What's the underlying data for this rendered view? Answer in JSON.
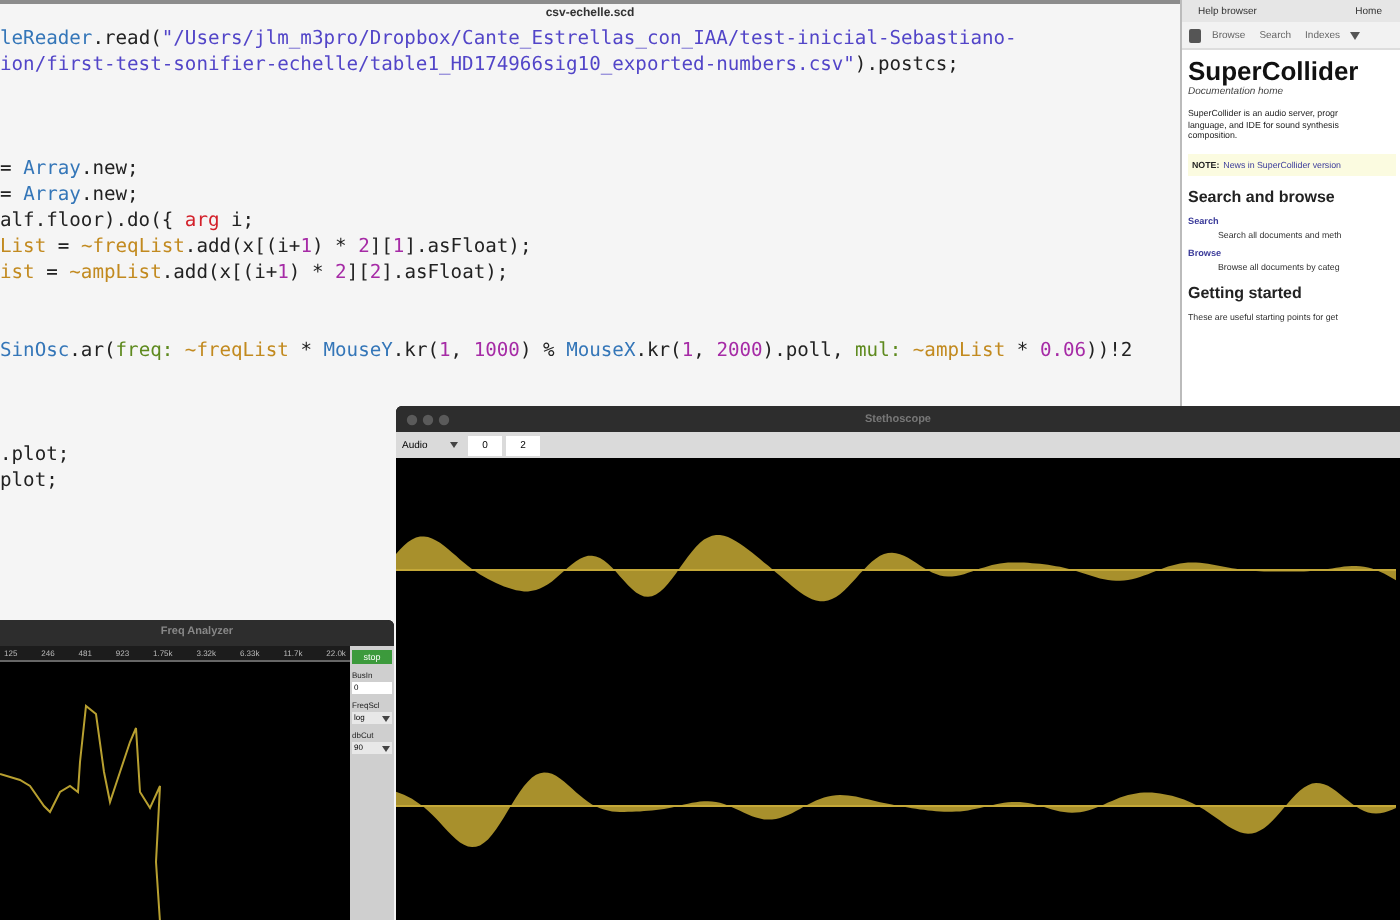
{
  "editor": {
    "title": "csv-echelle.scd",
    "lines": [
      {
        "kind": "code",
        "tokens": [
          {
            "text": "leReader",
            "kind": "class"
          },
          {
            "text": ".read(",
            "kind": "plain"
          },
          {
            "text": "\"/Users/jlm_m3pro/Dropbox/Cante_Estrellas_con_IAA/test-inicial-Sebastiano-",
            "kind": "string"
          }
        ]
      },
      {
        "kind": "code",
        "tokens": [
          {
            "text": "ion/first-test-sonifier-echelle/table1_HD174966sig10_exported-numbers.csv\"",
            "kind": "string"
          },
          {
            "text": ").postcs;",
            "kind": "plain"
          }
        ]
      },
      {
        "kind": "blank"
      },
      {
        "kind": "blank"
      },
      {
        "kind": "blank"
      },
      {
        "kind": "code",
        "tokens": [
          {
            "text": "= ",
            "kind": "plain"
          },
          {
            "text": "Array",
            "kind": "class"
          },
          {
            "text": ".new;",
            "kind": "plain"
          }
        ]
      },
      {
        "kind": "code",
        "tokens": [
          {
            "text": "= ",
            "kind": "plain"
          },
          {
            "text": "Array",
            "kind": "class"
          },
          {
            "text": ".new;",
            "kind": "plain"
          }
        ]
      },
      {
        "kind": "code",
        "tokens": [
          {
            "text": "alf.floor).do({ ",
            "kind": "plain"
          },
          {
            "text": "arg",
            "kind": "keyword"
          },
          {
            "text": " i;",
            "kind": "plain"
          }
        ]
      },
      {
        "kind": "code",
        "tokens": [
          {
            "text": "List",
            "kind": "env"
          },
          {
            "text": " = ",
            "kind": "plain"
          },
          {
            "text": "~freqList",
            "kind": "env"
          },
          {
            "text": ".add(x[(i+",
            "kind": "plain"
          },
          {
            "text": "1",
            "kind": "number"
          },
          {
            "text": ") * ",
            "kind": "plain"
          },
          {
            "text": "2",
            "kind": "number"
          },
          {
            "text": "][",
            "kind": "plain"
          },
          {
            "text": "1",
            "kind": "number"
          },
          {
            "text": "].asFloat);",
            "kind": "plain"
          }
        ]
      },
      {
        "kind": "code",
        "tokens": [
          {
            "text": "ist",
            "kind": "env"
          },
          {
            "text": " = ",
            "kind": "plain"
          },
          {
            "text": "~ampList",
            "kind": "env"
          },
          {
            "text": ".add(x[(i+",
            "kind": "plain"
          },
          {
            "text": "1",
            "kind": "number"
          },
          {
            "text": ") * ",
            "kind": "plain"
          },
          {
            "text": "2",
            "kind": "number"
          },
          {
            "text": "][",
            "kind": "plain"
          },
          {
            "text": "2",
            "kind": "number"
          },
          {
            "text": "].asFloat);",
            "kind": "plain"
          }
        ]
      },
      {
        "kind": "blank"
      },
      {
        "kind": "blank"
      },
      {
        "kind": "code",
        "tokens": [
          {
            "text": "SinOsc",
            "kind": "class"
          },
          {
            "text": ".ar(",
            "kind": "plain"
          },
          {
            "text": "freq:",
            "kind": "symbol"
          },
          {
            "text": " ~freqList",
            "kind": "env"
          },
          {
            "text": " * ",
            "kind": "plain"
          },
          {
            "text": "MouseY",
            "kind": "class"
          },
          {
            "text": ".kr(",
            "kind": "plain"
          },
          {
            "text": "1",
            "kind": "number"
          },
          {
            "text": ", ",
            "kind": "plain"
          },
          {
            "text": "1000",
            "kind": "number"
          },
          {
            "text": ") % ",
            "kind": "plain"
          },
          {
            "text": "MouseX",
            "kind": "class"
          },
          {
            "text": ".kr(",
            "kind": "plain"
          },
          {
            "text": "1",
            "kind": "number"
          },
          {
            "text": ", ",
            "kind": "plain"
          },
          {
            "text": "2000",
            "kind": "number"
          },
          {
            "text": ").poll, ",
            "kind": "plain"
          },
          {
            "text": "mul:",
            "kind": "symbol"
          },
          {
            "text": " ~ampList",
            "kind": "env"
          },
          {
            "text": " * ",
            "kind": "plain"
          },
          {
            "text": "0.06",
            "kind": "number"
          },
          {
            "text": "))!2",
            "kind": "plain"
          }
        ]
      },
      {
        "kind": "blank"
      },
      {
        "kind": "blank"
      },
      {
        "kind": "blank"
      },
      {
        "kind": "code",
        "tokens": [
          {
            "text": ".plot;",
            "kind": "plain"
          }
        ]
      },
      {
        "kind": "code",
        "tokens": [
          {
            "text": "plot;",
            "kind": "plain"
          }
        ]
      }
    ]
  },
  "help": {
    "title": "Help browser",
    "home": "Home",
    "toolbar": [
      "Browse",
      "Search",
      "Indexes"
    ],
    "heading": "SuperCollider",
    "subtitle": "Documentation home",
    "intro": "SuperCollider is an audio server, progr\nlanguage, and IDE for sound synthesis\ncomposition.",
    "note": {
      "label": "NOTE:",
      "link": "News in SuperCollider version"
    },
    "blocks": [
      {
        "kind": "heading",
        "text": "Search and browse"
      },
      {
        "kind": "link",
        "text": "Search"
      },
      {
        "kind": "desc",
        "text": "Search all documents and meth"
      },
      {
        "kind": "link",
        "text": "Browse"
      },
      {
        "kind": "desc",
        "text": "Browse all documents by categ"
      },
      {
        "kind": "heading",
        "text": "Getting started"
      },
      {
        "kind": "para",
        "text": "These are useful starting points for get"
      }
    ]
  },
  "scope": {
    "title": "Stethoscope",
    "source": "Audio",
    "fields": [
      "0",
      "2"
    ]
  },
  "analyzer": {
    "title": "Freq Analyzer",
    "axis_labels": [
      "125",
      "246",
      "481",
      "923",
      "1.75k",
      "3.32k",
      "6.33k",
      "11.7k",
      "22.0k"
    ],
    "stop": "stop",
    "controls": [
      {
        "kind": "label",
        "text": "BusIn"
      },
      {
        "kind": "field",
        "text": "0"
      },
      {
        "kind": "label",
        "text": "FreqScl"
      },
      {
        "kind": "select",
        "text": "log"
      },
      {
        "kind": "label",
        "text": "dbCut"
      },
      {
        "kind": "select",
        "text": "90"
      }
    ]
  }
}
